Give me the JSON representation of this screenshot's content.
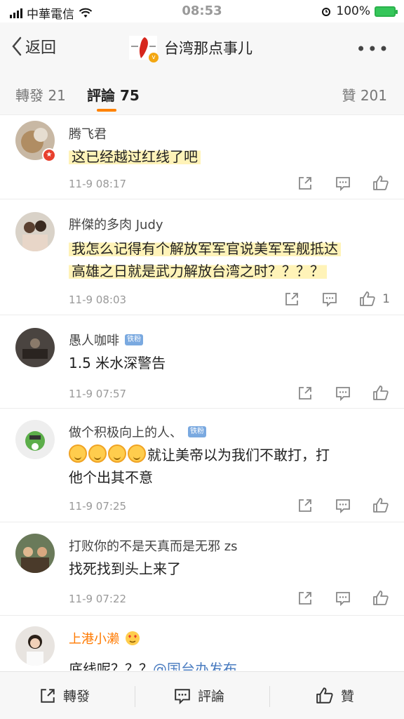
{
  "status_bar": {
    "carrier": "中華電信",
    "time": "08:53",
    "battery": "100%"
  },
  "nav": {
    "back_label": "返回",
    "title": "台湾那点事儿",
    "more_label": "•••"
  },
  "tabs": {
    "forward": "轉發 21",
    "comments": "評論 75",
    "likes": "贊 201"
  },
  "comments": [
    {
      "name": "腾飞君",
      "text": "这已经越过红线了吧",
      "time": "11-9 08:17",
      "likes": ""
    },
    {
      "name": "胖傑的多肉 Judy",
      "text_line1": "我怎么记得有个解放军军官说美军军舰抵达",
      "text_line2": "高雄之日就是武力解放台湾之时？？？？",
      "time": "11-9 08:03",
      "likes": "1"
    },
    {
      "name": "愚人咖啡",
      "badge": "铁粉",
      "text": "1.5 米水深警告",
      "time": "11-9 07:57",
      "likes": ""
    },
    {
      "name": "做个积极向上的人、",
      "badge": "铁粉",
      "text_line1": "就让美帝以为我们不敢打，打",
      "text_line2": "他个出其不意",
      "time": "11-9 07:25",
      "likes": ""
    },
    {
      "name": "打败你的不是天真而是无邪 zs",
      "text": "找死找到头上来了",
      "time": "11-9 07:22",
      "likes": ""
    },
    {
      "name": "上港小濑",
      "text": "底线呢？？？",
      "mention": "@国台办发布",
      "time": "",
      "likes": ""
    }
  ],
  "toolbar": {
    "forward": "轉發",
    "comment": "評論",
    "like": "贊"
  },
  "colors": {
    "accent": "#ff8200",
    "highlight": "#fff3b8",
    "mention": "#4a7cc0",
    "fan_badge": "#7aa9e0"
  }
}
